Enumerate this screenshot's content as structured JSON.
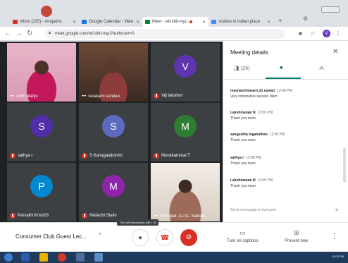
{
  "browser": {
    "tabs": [
      {
        "label": "Inbox (235) - mrujalnic",
        "favicon_color": "#d93025"
      },
      {
        "label": "Google Calendar - Wee",
        "favicon_color": "#1a73e8"
      },
      {
        "label": "Meet - wll-xbii-myu",
        "favicon_color": "#00832d",
        "recording": true
      },
      {
        "label": "studies in indian place",
        "favicon_color": "#4285f4"
      }
    ],
    "new_tab": "+",
    "url": "meet.google.com/wll-xbii-myu?authuser=0",
    "account_initial": "V"
  },
  "participants": [
    {
      "name": "Arthi Manju",
      "muted": false,
      "more": true,
      "photo": true
    },
    {
      "name": "sivakami sundari",
      "muted": false,
      "more": true,
      "photo": true
    },
    {
      "name": "Viji lakshmi",
      "muted": true,
      "initial": "V",
      "color": "#5e35b1"
    },
    {
      "name": "sathya r",
      "muted": true,
      "initial": "S",
      "color": "#512da8"
    },
    {
      "name": "S Kanagalakshmi",
      "muted": true,
      "initial": "S",
      "color": "#5c6bc0"
    },
    {
      "name": "Mookkammal T",
      "muted": true,
      "initial": "M",
      "color": "#2e7d32"
    },
    {
      "name": "Parvathi Krish03",
      "muted": true,
      "initial": "P",
      "color": "#0288d1"
    },
    {
      "name": "Malaichi Stalin",
      "muted": true,
      "initial": "M",
      "color": "#8e24aa"
    },
    {
      "name": "Principal, A.P.C. Mahale...",
      "muted": false,
      "more": true,
      "photo": true
    }
  ],
  "tooltip": "Turn off microphone (ctrl + d)",
  "bottombar": {
    "meeting_title": "Consumer Club Guest Lec...",
    "captions_label": "Turn on captions",
    "present_label": "Present now"
  },
  "panel": {
    "title": "Meeting details",
    "people_count": "(29)",
    "messages": [
      {
        "sender": "meenatchiswarri.21 eswari",
        "time": "12:00 PM",
        "text": "Very informative session Mam"
      },
      {
        "sender": "Lakshmanan N",
        "time": "12:00 PM",
        "text": "Thank you mam"
      },
      {
        "sender": "sangeetha loganathan",
        "time": "12:00 PM",
        "text": "Thank you mam"
      },
      {
        "sender": "sathya r",
        "time": "12:00 PM",
        "text": "Thank you mam"
      },
      {
        "sender": "Lakshmanan N",
        "time": "12:00 PM",
        "text": "Thank you mam"
      }
    ],
    "send_placeholder": "Send a message to everyone"
  },
  "taskbar": {
    "clock": "12:00 PM"
  },
  "colors": {
    "accent": "#00796b",
    "hangup": "#d93025",
    "chrome_bg": "#dee1e6",
    "grid_bg": "#202124"
  }
}
